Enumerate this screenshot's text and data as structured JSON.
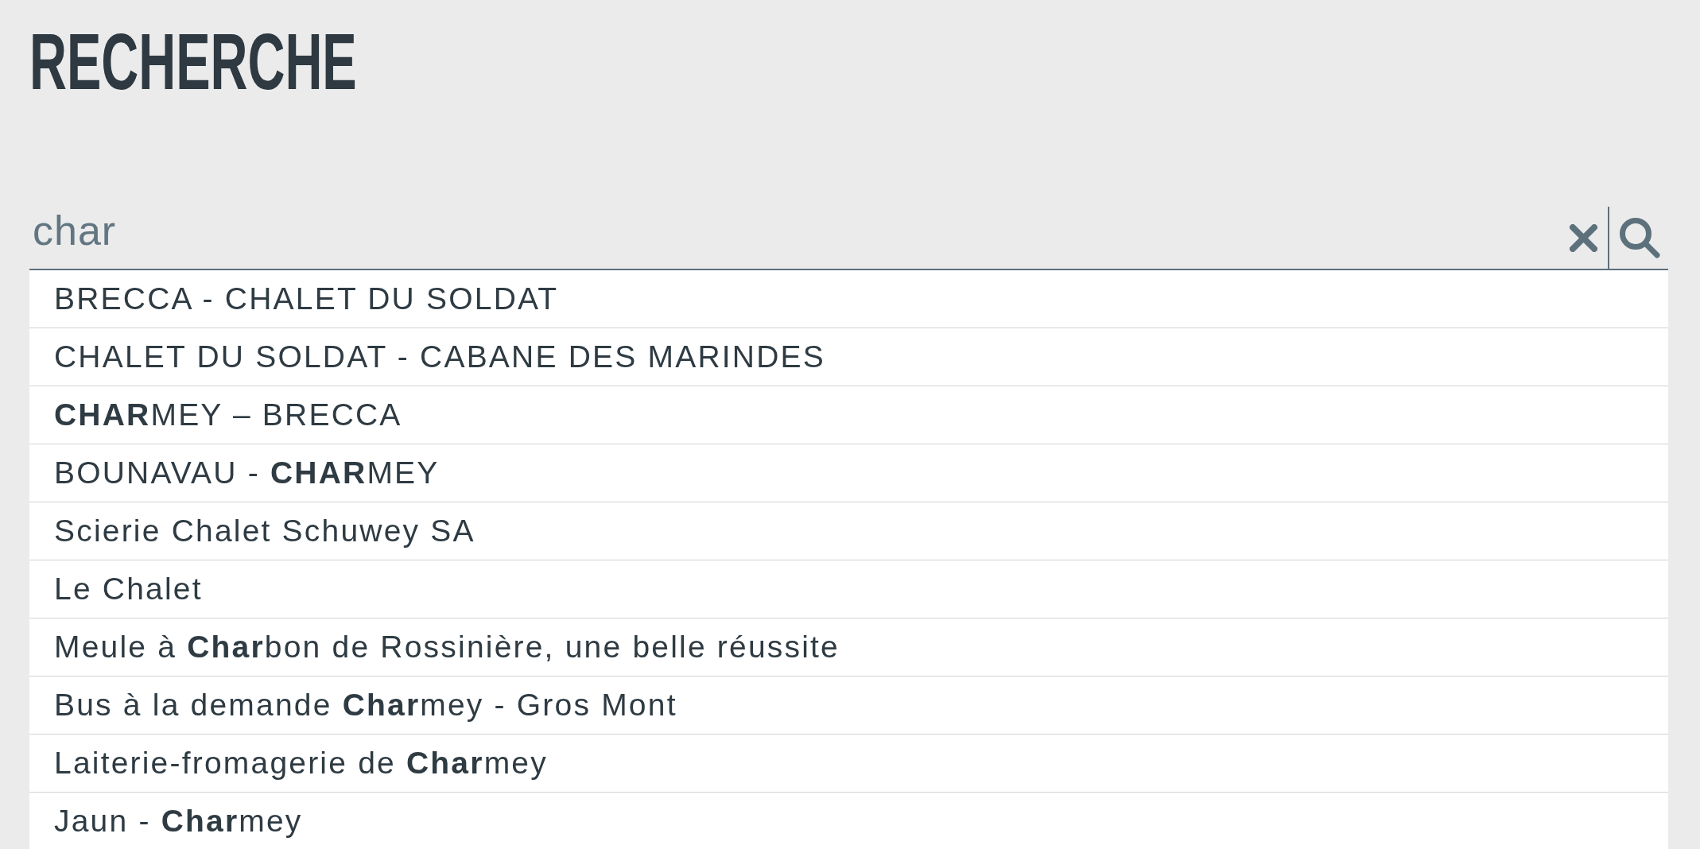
{
  "title": "RECHERCHE",
  "search": {
    "value": "char"
  },
  "results": [
    "BRECCA - CHALET DU SOLDAT",
    "CHALET DU SOLDAT - CABANE DES MARINDES",
    "**CHAR**MEY – BRECCA",
    "BOUNAVAU - **CHAR**MEY",
    "Scierie Chalet Schuwey SA",
    "Le Chalet",
    "Meule à **Char**bon de Rossinière, une belle réussite",
    "Bus à la demande **Char**mey - Gros Mont",
    "Laiterie-fromagerie de **Char**mey",
    "Jaun - **Char**mey"
  ]
}
